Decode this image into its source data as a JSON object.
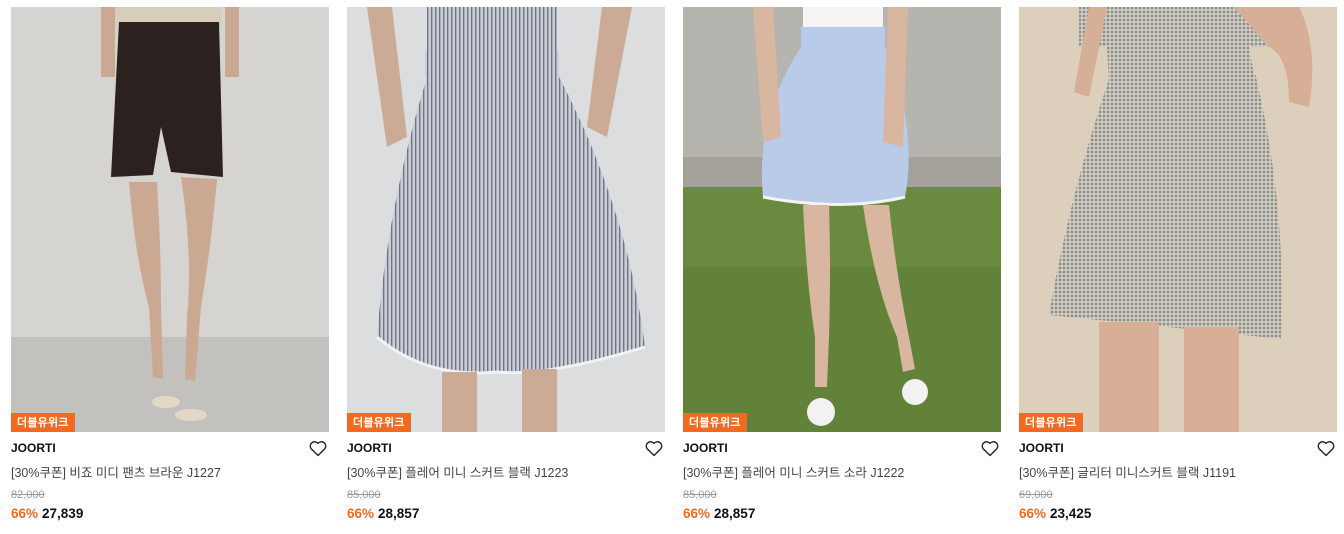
{
  "accent_color": "#f26a22",
  "products": [
    {
      "badge": "더블유위크",
      "brand": "JOORTI",
      "title": "[30%쿠폰] 비죠 미디 팬츠 브라운 J1227",
      "original_price": "82,000",
      "discount": "66%",
      "sale_price": "27,839"
    },
    {
      "badge": "더블유위크",
      "brand": "JOORTI",
      "title": "[30%쿠폰] 플레어 미니 스커트 블랙 J1223",
      "original_price": "85,000",
      "discount": "66%",
      "sale_price": "28,857"
    },
    {
      "badge": "더블유위크",
      "brand": "JOORTI",
      "title": "[30%쿠폰] 플레어 미니 스커트 소라 J1222",
      "original_price": "85,000",
      "discount": "66%",
      "sale_price": "28,857"
    },
    {
      "badge": "더블유위크",
      "brand": "JOORTI",
      "title": "[30%쿠폰] 글리터 미니스커트 블랙 J1191",
      "original_price": "69,000",
      "discount": "66%",
      "sale_price": "23,425"
    }
  ],
  "icons": {
    "wishlist": "heart-outline-icon"
  }
}
